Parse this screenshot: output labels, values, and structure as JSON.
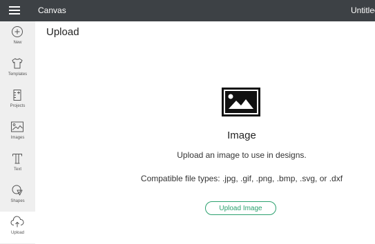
{
  "header": {
    "menu_icon": "hamburger-icon",
    "app_title": "Canvas",
    "doc_title": "Untitled"
  },
  "sidebar": {
    "items": [
      {
        "label": "New",
        "icon": "plus-circle-icon"
      },
      {
        "label": "Templates",
        "icon": "tshirt-icon"
      },
      {
        "label": "Projects",
        "icon": "projects-icon"
      },
      {
        "label": "Images",
        "icon": "image-icon"
      },
      {
        "label": "Text",
        "icon": "text-icon"
      },
      {
        "label": "Shapes",
        "icon": "shapes-icon"
      },
      {
        "label": "Upload",
        "icon": "upload-icon",
        "active": true
      }
    ]
  },
  "main": {
    "title": "Upload",
    "section": {
      "icon": "image-icon",
      "heading": "Image",
      "description": "Upload an image to use in designs.",
      "file_types": "Compatible file types: .jpg, .gif, .png, .bmp, .svg, or .dxf",
      "button_label": "Upload Image"
    }
  },
  "colors": {
    "topbar": "#3d4145",
    "sidebar": "#efefef",
    "accent": "#2aa06d"
  }
}
